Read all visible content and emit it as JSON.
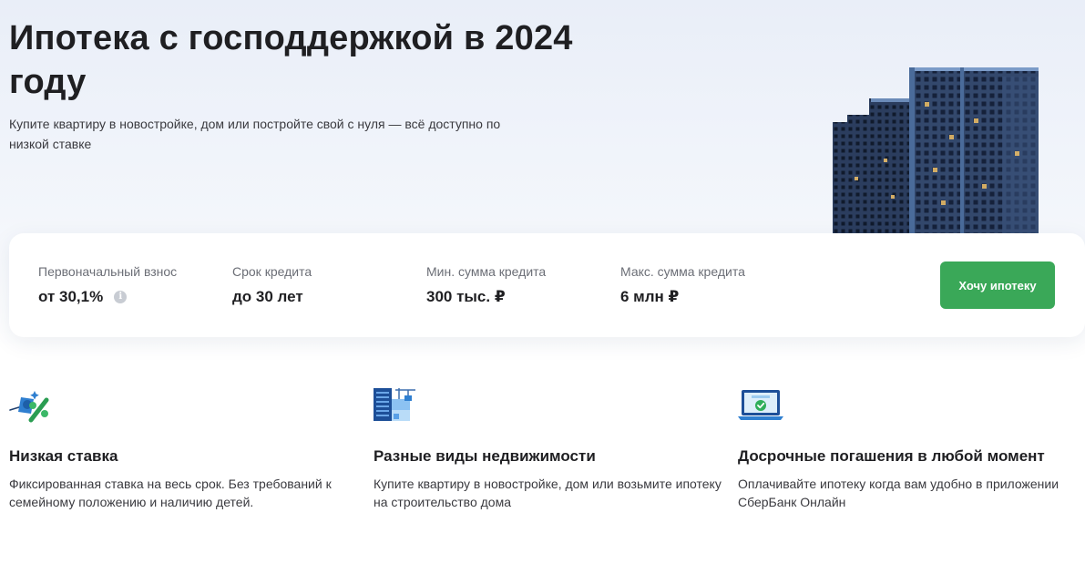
{
  "hero": {
    "title": "Ипотека с господдержкой в 2024 году",
    "subtitle": "Купите квартиру в новостройке, дом или постройте свой с нуля — всё доступно по низкой ставке"
  },
  "params": [
    {
      "label": "Первоначальный взнос",
      "value": "от 30,1%"
    },
    {
      "label": "Срок кредита",
      "value": "до 30 лет"
    },
    {
      "label": "Мин. сумма кредита",
      "value": "300 тыс. ₽"
    },
    {
      "label": "Макс. сумма кредита",
      "value": "6 млн ₽"
    }
  ],
  "info_icon": {
    "glyph": "i",
    "icon": "info-icon"
  },
  "cta": {
    "label": "Хочу ипотеку",
    "color": "#3aa858"
  },
  "features": [
    {
      "icon": "percent-icon",
      "title": "Низкая ставка",
      "text": "Фиксированная ставка на весь срок. Без требований к семейному положению и наличию детей."
    },
    {
      "icon": "building-crane-icon",
      "title": "Разные виды недвижимости",
      "text": "Купите квартиру в новостройке, дом или возьмите ипотеку на строительство дома"
    },
    {
      "icon": "laptop-check-icon",
      "title": "Досрочные погашения в любой момент",
      "text": "Оплачивайте ипотеку когда вам удобно в приложении СберБанк Онлайн"
    }
  ],
  "colors": {
    "accent_green": "#3aa858",
    "icon_blue": "#2f7fd0",
    "text_dark": "#1f1f22",
    "text_muted": "#6b6e76"
  }
}
